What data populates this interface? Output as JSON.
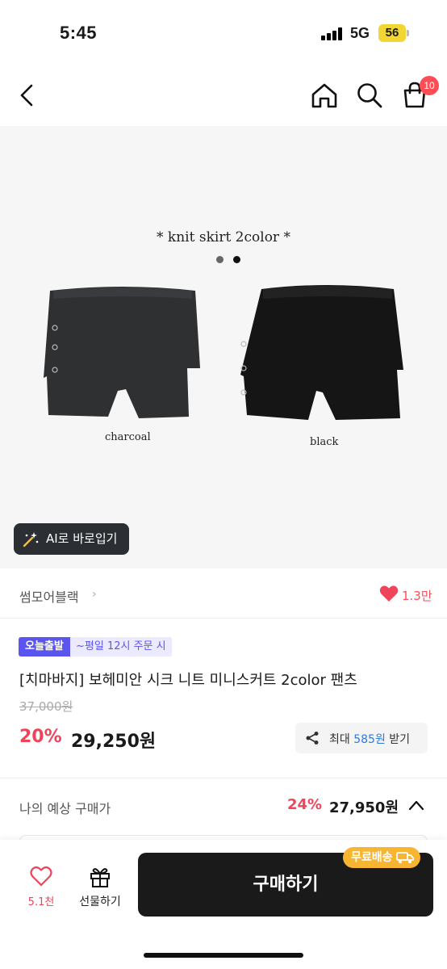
{
  "status_bar": {
    "time": "5:45",
    "network": "5G",
    "battery": "56"
  },
  "nav": {
    "cart_badge": "10"
  },
  "product_image": {
    "title": "* knit skirt 2color *",
    "captions": [
      "charcoal",
      "black"
    ],
    "colors": {
      "charcoal": "#2f3032",
      "black": "#151515"
    }
  },
  "ai_button": {
    "label": "AI로 바로입기"
  },
  "seller": {
    "name": "썸모어블랙",
    "chevron": "›",
    "likes": "1.3만"
  },
  "badges": {
    "today": "오늘출발",
    "when": "~평일 12시 주문 시"
  },
  "product": {
    "title": "[치마바지] 보헤미안 시크 니트 미니스커트 2color 팬츠",
    "original_price": "37,000원",
    "discount": "20%",
    "price": "29,250원"
  },
  "points": {
    "prefix": "최대 ",
    "amount": "585원",
    "suffix": " 받기"
  },
  "expected": {
    "label": "나의 예상 구매가",
    "discount": "24%",
    "price": "27,950원"
  },
  "bottom_bar": {
    "wish_count": "5.1천",
    "gift_label": "선물하기",
    "buy_label": "구매하기",
    "free_shipping": "무료배송"
  },
  "colors": {
    "accent_red": "#f0445a",
    "badge_purple": "#5b55f0",
    "link_blue": "#2f7bdc",
    "shipping_yellow": "#f7b531"
  }
}
